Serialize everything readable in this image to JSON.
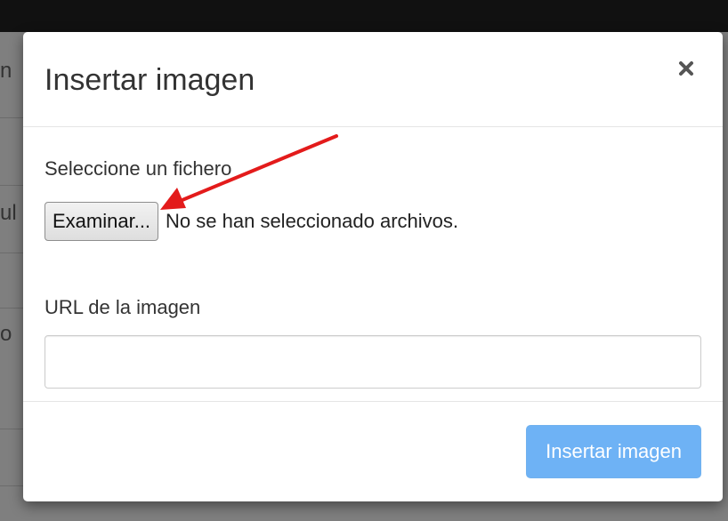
{
  "background": {
    "fragments": [
      "n",
      "ul",
      "o"
    ]
  },
  "modal": {
    "title": "Insertar imagen",
    "close_icon": "close-icon",
    "file_label": "Seleccione un fichero",
    "file_button_label": "Examinar...",
    "file_status": "No se han seleccionado archivos.",
    "url_label": "URL de la imagen",
    "url_value": "",
    "url_placeholder": "",
    "submit_label": "Insertar imagen"
  },
  "annotation": {
    "type": "arrow",
    "color": "#e31b1b",
    "points_to": "file-button"
  },
  "colors": {
    "primary_disabled": "#6eb2f5",
    "backdrop": "#7f7f7f",
    "title_text": "#333333"
  }
}
